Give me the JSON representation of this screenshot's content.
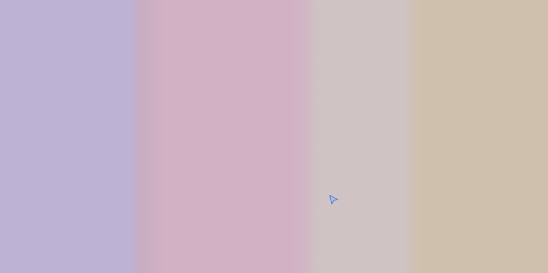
{
  "background": {
    "bands": [
      {
        "name": "lavender",
        "color": "#bdb2d4"
      },
      {
        "name": "rose",
        "color": "#d3b1c4"
      },
      {
        "name": "blush",
        "color": "#cfc3c4"
      },
      {
        "name": "sand",
        "color": "#cfc0ae"
      }
    ],
    "transition_colors": {
      "lavender_to_rose": "#c8adc0",
      "rose_to_blush": "#d2b8c3",
      "blush_to_sand": "#d0c1b8"
    }
  },
  "cursor": {
    "icon": "pointer-cursor-icon",
    "fill": "#a9c4ee",
    "stroke": "#4f7fd3"
  }
}
